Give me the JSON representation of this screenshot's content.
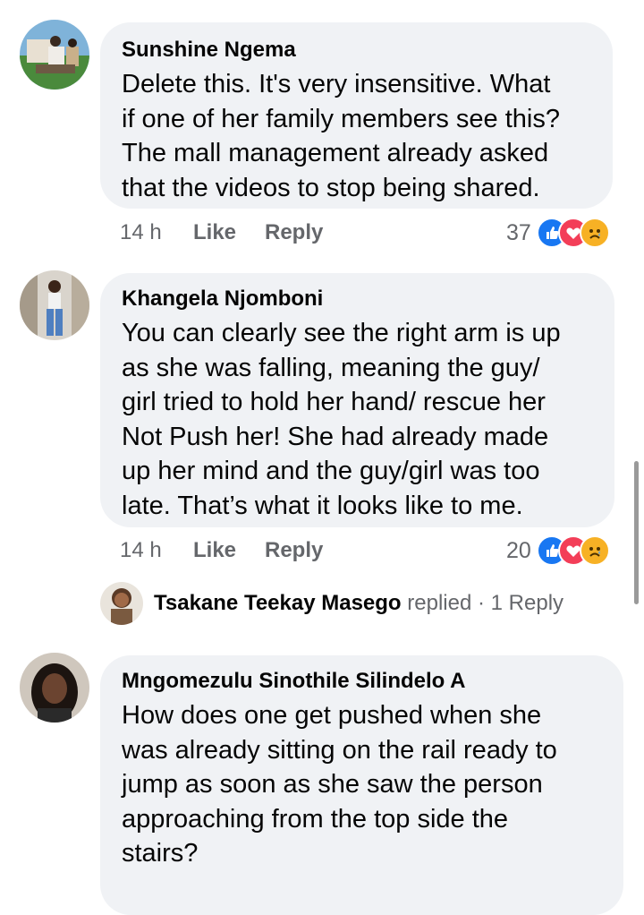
{
  "comments": [
    {
      "author": "Sunshine Ngema",
      "text": "Delete this. It's very insensitive. What\nif one of her family members see this?\nThe mall management already asked\nthat the videos to stop being shared.",
      "time": "14 h",
      "like_label": "Like",
      "reply_label": "Reply",
      "reaction_count": "37",
      "reactions": [
        "like-icon",
        "love-icon",
        "sad-icon"
      ]
    },
    {
      "author": "Khangela Njomboni",
      "text": "You can clearly see the right arm is up\nas she was falling, meaning the guy/\ngirl tried to hold her hand/ rescue her\nNot Push her! She had already made\nup her mind and the guy/girl was too\nlate. That’s what it looks like to me.",
      "time": "14 h",
      "like_label": "Like",
      "reply_label": "Reply",
      "reaction_count": "20",
      "reactions": [
        "like-icon",
        "love-icon",
        "sad-icon"
      ],
      "replies_summary": {
        "name": "Tsakane Teekay Masego",
        "action": "replied",
        "separator": "·",
        "count_label": "1 Reply"
      }
    },
    {
      "author": "Mngomezulu Sinothile Silindelo A",
      "text": "How does one get pushed when she\nwas already sitting on the rail ready to\njump as soon as she saw the person\napproaching from the top side the\nstairs?"
    }
  ],
  "colors": {
    "bubble": "#f0f2f5",
    "secondary_text": "#65676b",
    "like_blue": "#1877f2",
    "love_red": "#f33e58",
    "sad_yellow": "#f7b125"
  }
}
